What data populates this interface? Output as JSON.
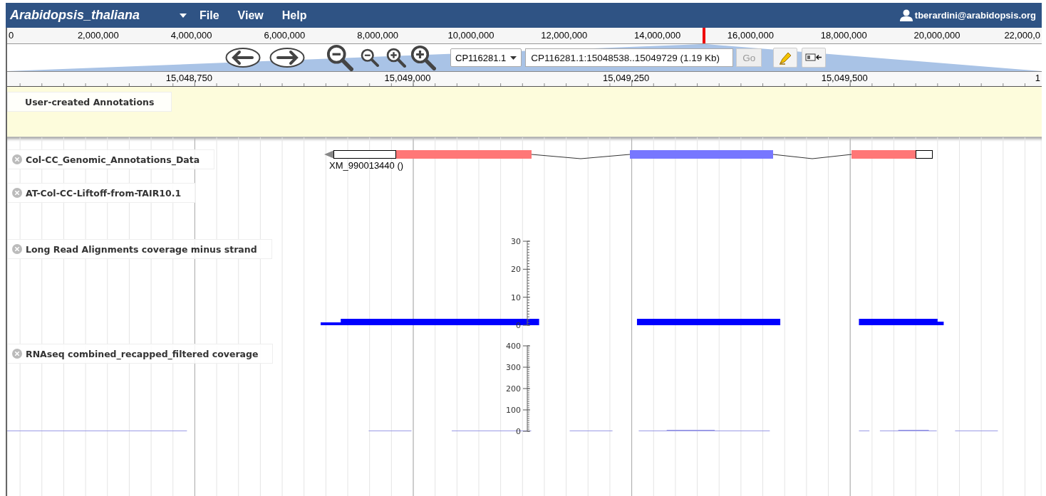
{
  "menubar": {
    "dataset": "Arabidopsis_thaliana",
    "menus": [
      "File",
      "View",
      "Help"
    ],
    "user": "tberardini@arabidopsis.org"
  },
  "overview": {
    "labels": [
      "0",
      "2,000,000",
      "4,000,000",
      "6,000,000",
      "8,000,000",
      "10,000,000",
      "12,000,000",
      "14,000,000",
      "16,000,000",
      "18,000,000",
      "20,000,000",
      "22,000,0"
    ]
  },
  "navigation": {
    "sequence": "CP116281.1",
    "location": "CP116281.1:15048538..15049729 (1.19 Kb)",
    "go": {
      "label": "Go",
      "disabled": true
    }
  },
  "ruler": {
    "labels": [
      "15,048,750",
      "15,049,000",
      "15,049,250",
      "15,049,500",
      "1"
    ]
  },
  "user_annotations": {
    "label": "User-created Annotations"
  },
  "tracks": [
    {
      "kind": "gene",
      "label": "Col-CC_Genomic_Annotations_Data",
      "feature_label": "XM_990013440 ()"
    },
    {
      "kind": "empty",
      "label": "AT-Col-CC-Liftoff-from-TAIR10.1"
    },
    {
      "kind": "coverage",
      "label": "Long Read Alignments coverage minus strand",
      "axis_labels": [
        "30",
        "20",
        "10",
        "0"
      ]
    },
    {
      "kind": "coverage",
      "label": "RNAseq combined_recapped_filtered coverage",
      "axis_labels": [
        "400",
        "300",
        "200",
        "100",
        "0"
      ]
    }
  ]
}
